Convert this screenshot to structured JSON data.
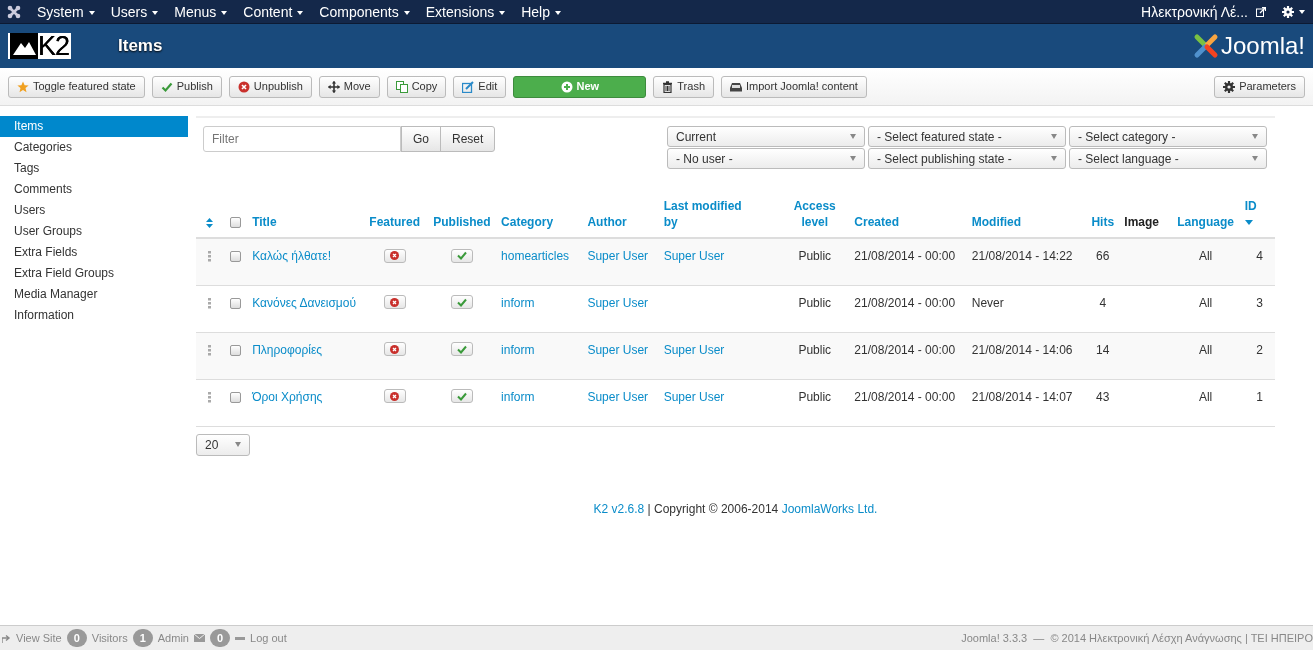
{
  "menu": {
    "items": [
      {
        "label": "System"
      },
      {
        "label": "Users"
      },
      {
        "label": "Menus"
      },
      {
        "label": "Content"
      },
      {
        "label": "Components"
      },
      {
        "label": "Extensions"
      },
      {
        "label": "Help"
      }
    ],
    "site_link": "Ηλεκτρονική Λέ..."
  },
  "header": {
    "logo_text": "K2",
    "title": "Items",
    "brand": "Joomla!"
  },
  "toolbar": [
    {
      "label": "Toggle featured state",
      "kind": "star"
    },
    {
      "label": "Publish",
      "kind": "check"
    },
    {
      "label": "Unpublish",
      "kind": "cancel"
    },
    {
      "label": "Move",
      "kind": "move"
    },
    {
      "label": "Copy",
      "kind": "copy"
    },
    {
      "label": "Edit",
      "kind": "edit"
    },
    {
      "label": "New",
      "kind": "new"
    },
    {
      "label": "Trash",
      "kind": "trash"
    },
    {
      "label": "Import Joomla! content",
      "kind": "import"
    }
  ],
  "toolbar_right": {
    "label": "Parameters",
    "kind": "gear"
  },
  "sidebar": {
    "items": [
      {
        "label": "Items",
        "selected": true
      },
      {
        "label": "Categories",
        "selected": false
      },
      {
        "label": "Tags",
        "selected": false
      },
      {
        "label": "Comments",
        "selected": false
      },
      {
        "label": "Users",
        "selected": false
      },
      {
        "label": "User Groups",
        "selected": false
      },
      {
        "label": "Extra Fields",
        "selected": false
      },
      {
        "label": "Extra Field Groups",
        "selected": false
      },
      {
        "label": "Media Manager",
        "selected": false
      },
      {
        "label": "Information",
        "selected": false
      }
    ]
  },
  "filter": {
    "placeholder": "Filter",
    "go": "Go",
    "reset": "Reset"
  },
  "selects": [
    "Current",
    "- Select featured state -",
    "- Select category -",
    "- No user -",
    "- Select publishing state -",
    "- Select language -"
  ],
  "table": {
    "select_all_checked": false,
    "columns": [
      {
        "label": "Title",
        "link": true
      },
      {
        "label": "Featured",
        "link": true
      },
      {
        "label": "Published",
        "link": true
      },
      {
        "label": "Category",
        "link": true
      },
      {
        "label": "Author",
        "link": true
      },
      {
        "label": "Last modified by",
        "link": true
      },
      {
        "label": "Access level",
        "link": true
      },
      {
        "label": "Created",
        "link": true
      },
      {
        "label": "Modified",
        "link": true
      },
      {
        "label": "Hits",
        "link": true
      },
      {
        "label": "Image",
        "link": false
      },
      {
        "label": "Language",
        "link": true
      },
      {
        "label": "ID",
        "link": true,
        "sorted": true
      }
    ],
    "rows": [
      {
        "checked": false,
        "title": "Καλώς ήλθατε!",
        "featured": false,
        "published": true,
        "category": "homearticles",
        "author": "Super User",
        "modified_by": "Super User",
        "access": "Public",
        "created": "21/08/2014 - 00:00",
        "modified": "21/08/2014 - 14:22",
        "hits": "66",
        "language": "All",
        "id": "4"
      },
      {
        "checked": false,
        "title": "Κανόνες Δανεισμού",
        "featured": false,
        "published": true,
        "category": "inform",
        "author": "Super User",
        "access": "Public",
        "created": "21/08/2014 - 00:00",
        "modified": "Never",
        "hits": "4",
        "language": "All",
        "id": "3"
      },
      {
        "checked": false,
        "title": "Πληροφορίες",
        "featured": false,
        "published": true,
        "category": "inform",
        "author": "Super User",
        "modified_by": "Super User",
        "access": "Public",
        "created": "21/08/2014 - 00:00",
        "modified": "21/08/2014 - 14:06",
        "hits": "14",
        "language": "All",
        "id": "2"
      },
      {
        "checked": false,
        "title": "Όροι Χρήσης",
        "featured": false,
        "published": true,
        "category": "inform",
        "author": "Super User",
        "modified_by": "Super User",
        "access": "Public",
        "created": "21/08/2014 - 00:00",
        "modified": "21/08/2014 - 14:07",
        "hits": "43",
        "language": "All",
        "id": "1"
      }
    ]
  },
  "pager": {
    "limit": "20"
  },
  "footer": {
    "version": "K2 v2.6.8",
    "copyright": "| Copyright © 2006-2014",
    "company": "JoomlaWorks Ltd."
  },
  "status_bar": {
    "view_site": "View Site",
    "visitors_count": "0",
    "visitors": "Visitors",
    "admin_count": "1",
    "admin": "Admin",
    "messages_count": "0",
    "logout": "Log out",
    "right": "Joomla! 3.3.3  —  © 2014 Ηλεκτρονική Λέσχη Ανάγνωσης | ΤΕΙ ΗΠΕΙΡΟ"
  }
}
